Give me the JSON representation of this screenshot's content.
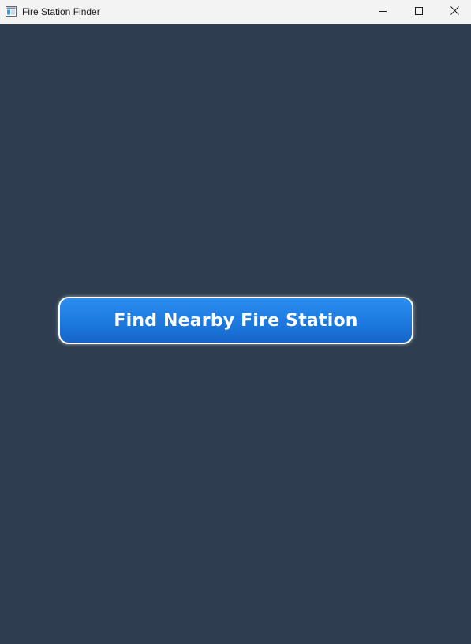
{
  "window": {
    "title": "Fire Station Finder",
    "icon": "window-app-icon",
    "controls": {
      "minimize_icon": "minimize-icon",
      "maximize_icon": "maximize-icon",
      "close_icon": "close-icon"
    }
  },
  "main": {
    "find_button_label": "Find Nearby Fire Station"
  },
  "colors": {
    "background": "#2e3e50",
    "titlebar": "#f3f3f3",
    "button_blue": "#1d79df",
    "button_border": "#ffffff"
  }
}
